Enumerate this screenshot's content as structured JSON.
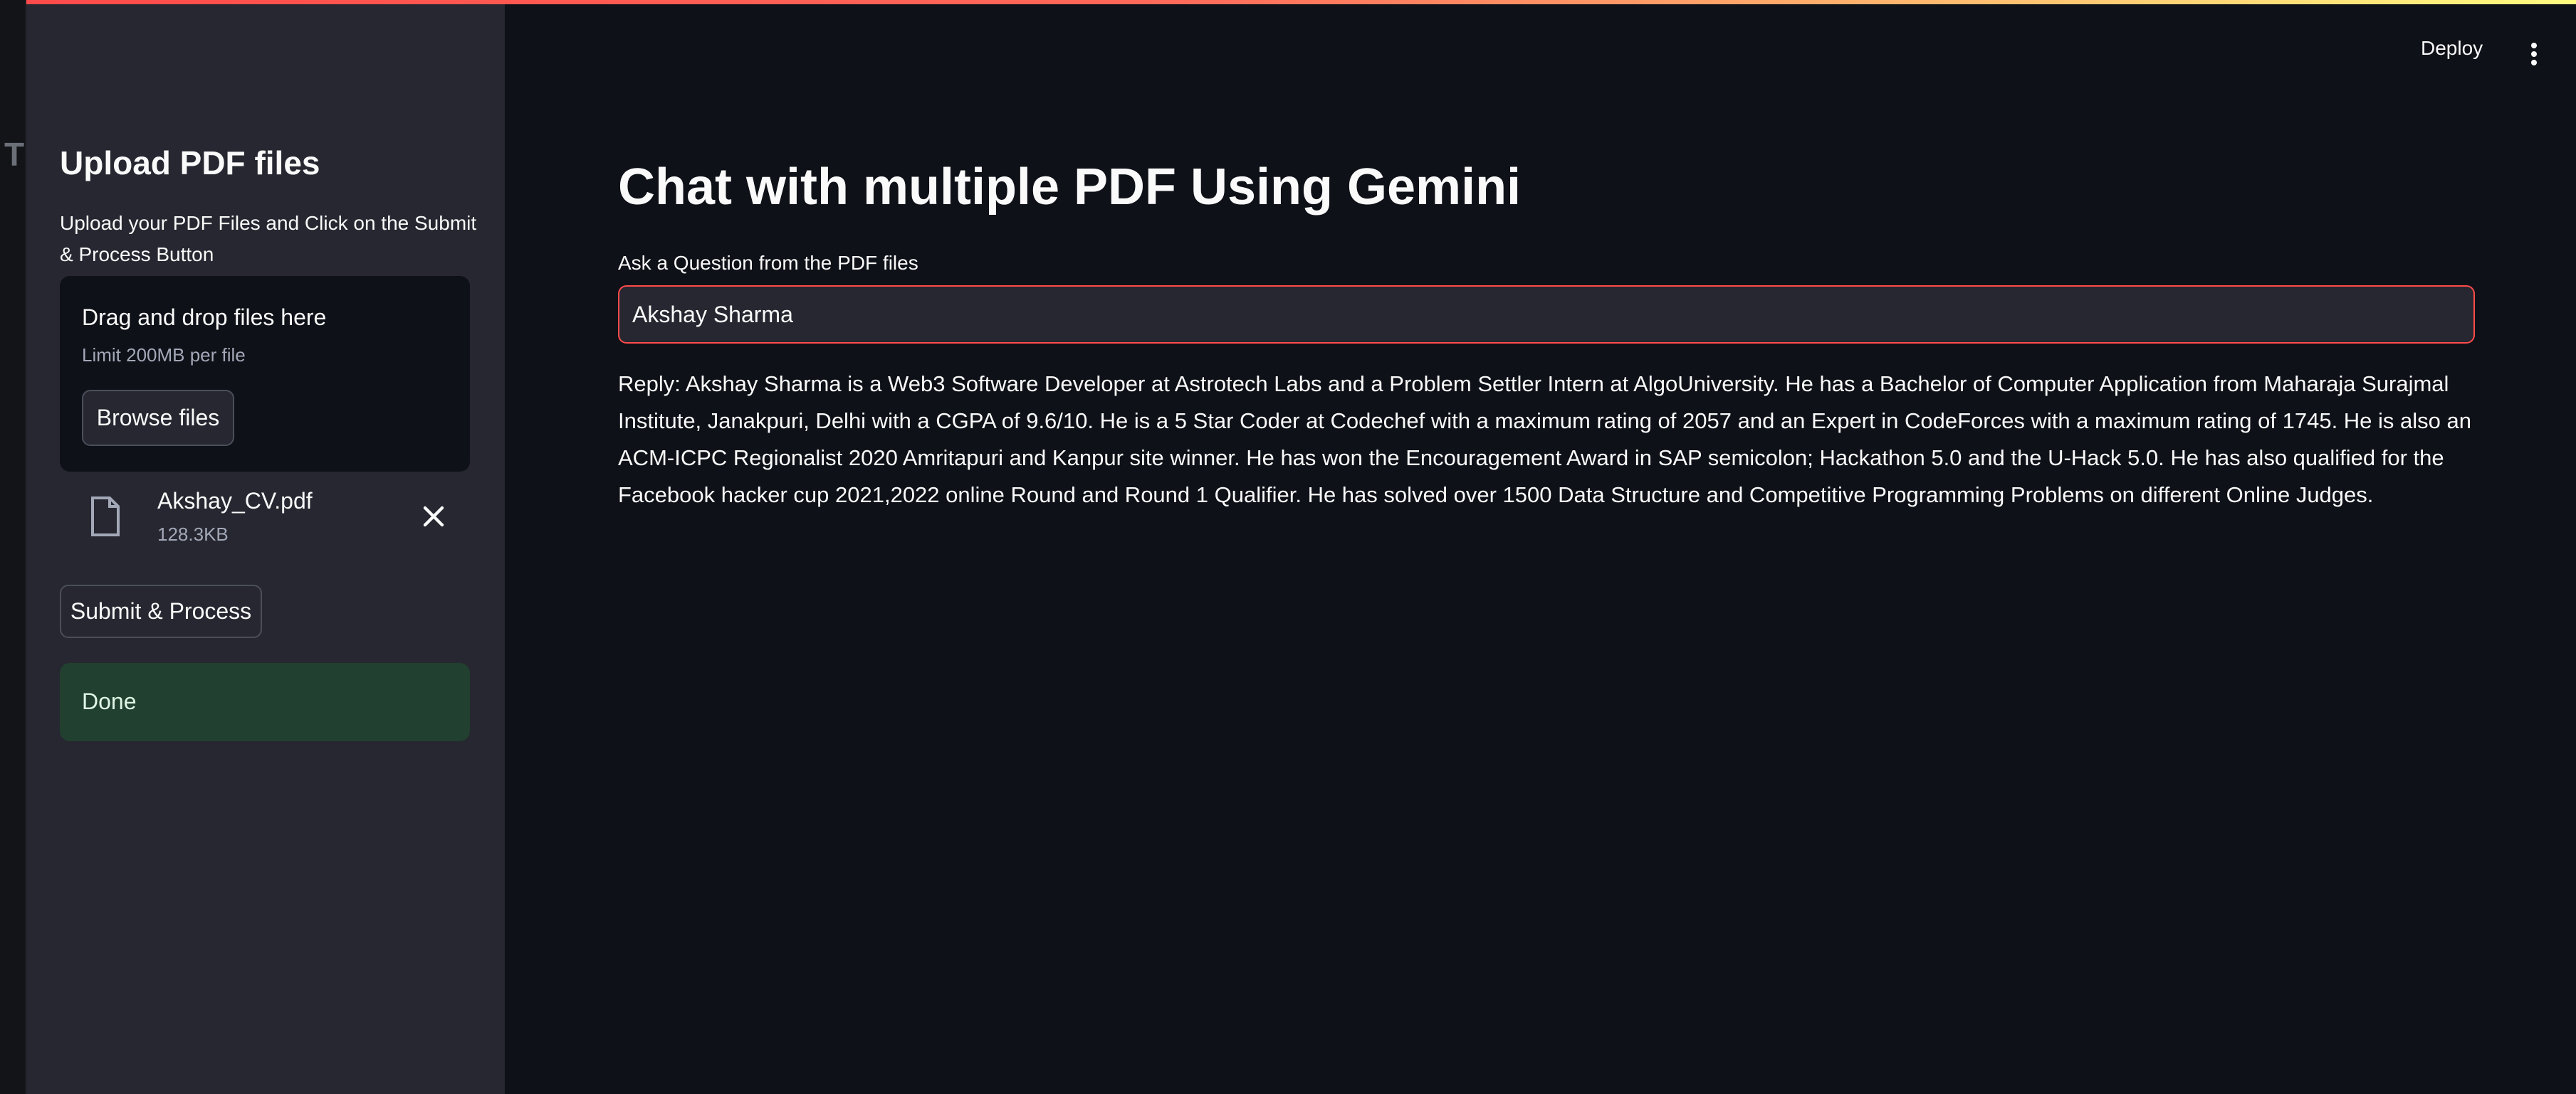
{
  "window": {
    "edge_letter": "T"
  },
  "header": {
    "deploy_label": "Deploy",
    "menu_icon": "kebab-menu-icon"
  },
  "sidebar": {
    "title": "Upload PDF files",
    "description": "Upload your PDF Files and Click on the Submit & Process Button",
    "dropzone": {
      "title": "Drag and drop files here",
      "limit": "Limit 200MB per file",
      "browse_label": "Browse files"
    },
    "file": {
      "name": "Akshay_CV.pdf",
      "size": "128.3KB",
      "icon": "file-icon",
      "remove_icon": "close-icon"
    },
    "submit_label": "Submit & Process",
    "status_text": "Done"
  },
  "main": {
    "title": "Chat with multiple PDF Using Gemini",
    "question_label": "Ask a Question from the PDF files",
    "question_value": "Akshay Sharma",
    "reply": "Reply: Akshay Sharma is a Web3 Software Developer at Astrotech Labs and a Problem Settler Intern at AlgoUniversity. He has a Bachelor of Computer Application from Maharaja Surajmal Institute, Janakpuri, Delhi with a CGPA of 9.6/10. He is a 5 Star Coder at Codechef with a maximum rating of 2057 and an Expert in CodeForces with a maximum rating of 1745. He is also an ACM-ICPC Regionalist 2020 Amritapuri and Kanpur site winner. He has won the Encouragement Award in SAP semicolon; Hackathon 5.0 and the U-Hack 5.0. He has also qualified for the Facebook hacker cup 2021,2022 online Round and Round 1 Qualifier. He has solved over 1500 Data Structure and Competitive Programming Problems on different Online Judges."
  },
  "colors": {
    "background": "#0e1117",
    "sidebar": "#262730",
    "accent": "#ff4b4b",
    "success_bg": "#21402f"
  }
}
